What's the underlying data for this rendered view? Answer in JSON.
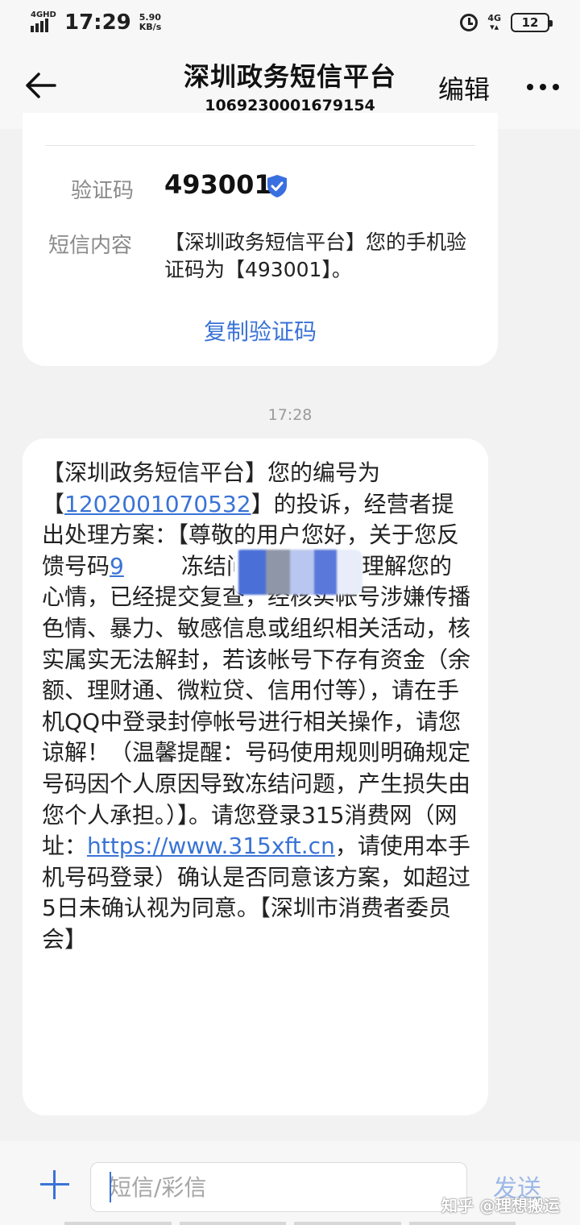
{
  "status_bar": {
    "network_type": "4GHD",
    "time": "17:29",
    "speed_value": "5.90",
    "speed_unit": "KB/s",
    "right_network": "4G",
    "battery": "12"
  },
  "header": {
    "title": "深圳政务短信平台",
    "number": "1069230001679154",
    "edit_label": "编辑"
  },
  "code_card": {
    "code_label": "验证码",
    "code_value": "493001",
    "content_label": "短信内容",
    "content_text": "【深圳政务短信平台】您的手机验证码为【493001】。",
    "copy_label": "复制验证码"
  },
  "timestamp": "17:28",
  "message": {
    "part1": "【深圳政务短信平台】您的编号为\n【",
    "complaint_id": "1202001070532",
    "part2": "】的投诉，经营者提出处理方案：【尊敬的用户您好，关于您反馈号码",
    "feedback_prefix": "9",
    "part3": "        冻结问题，我们很理解您的心情，已经提交复查，经核实帐号涉嫌传播色情、暴力、敏感信息或组织相关活动，核实属实无法解封，若该帐号下存有资金（余额、理财通、微粒贷、信用付等），请在手机QQ中登录封停帐号进行相关操作，请您谅解！（温馨提醒：号码使用规则明确规定号码因个人原因导致冻结问题，产生损失由您个人承担。）】。请您登录315消费网（网址：",
    "url": "https://www.315xft.cn",
    "part4": "，请使用本手机号码登录）确认是否同意该方案，如超过5日未确认视为同意。【深圳市消费者委员会】"
  },
  "input": {
    "placeholder": "短信/彩信",
    "send_label": "发送"
  },
  "watermark": "知乎 @理想搬运",
  "colors": {
    "accent": "#3a73d6",
    "background": "#f2f2f2",
    "card": "#ffffff"
  }
}
